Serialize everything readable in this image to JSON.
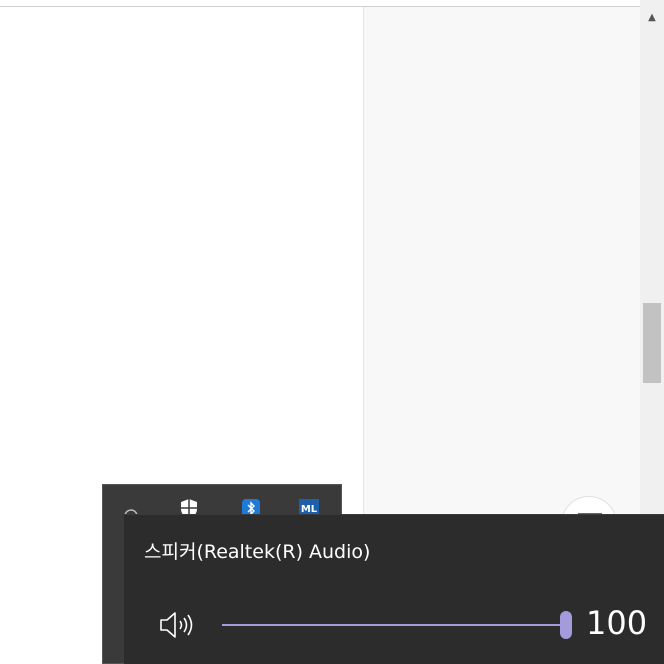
{
  "scroll": {
    "up_arrow": "▲"
  },
  "tray_overflow": {
    "icons": [
      "network-icon",
      "defender-icon",
      "bluetooth-icon",
      "ml-icon"
    ],
    "ml_label": "ML"
  },
  "volume": {
    "device_name": "스피커(Realtek(R) Audio)",
    "level": 100,
    "level_label": "100",
    "accent_color": "#a49bdc"
  }
}
